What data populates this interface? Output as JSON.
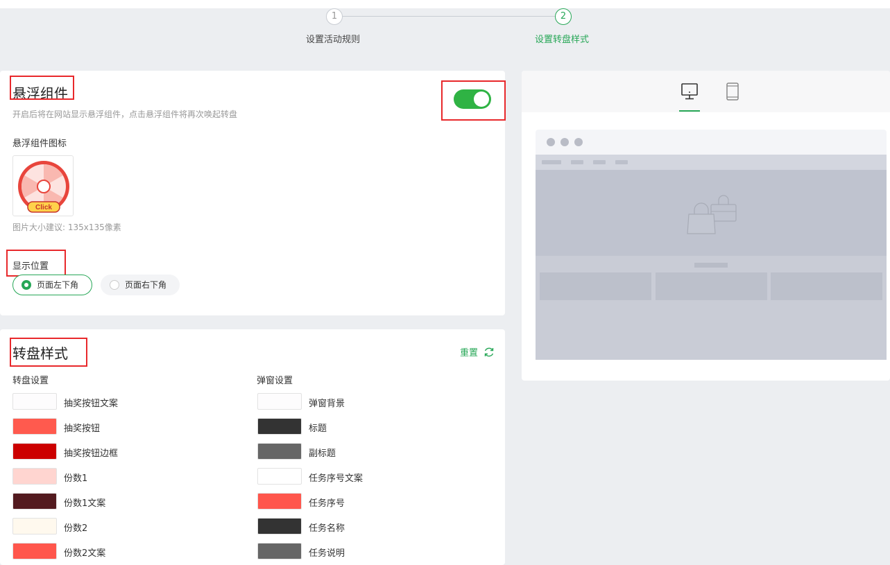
{
  "steps": [
    {
      "number": "1",
      "label": "设置活动规则"
    },
    {
      "number": "2",
      "label": "设置转盘样式"
    }
  ],
  "float_widget": {
    "title": "悬浮组件",
    "description": "开启后将在网站显示悬浮组件，点击悬浮组件将再次唤起转盘",
    "enabled": true,
    "icon_label": "悬浮组件图标",
    "icon_badge_text": "Click",
    "size_hint": "图片大小建议: 135x135像素",
    "position_label": "显示位置",
    "positions": [
      {
        "label": "页面左下角",
        "selected": true
      },
      {
        "label": "页面右下角",
        "selected": false
      }
    ]
  },
  "wheel_style": {
    "title": "转盘样式",
    "reset_label": "重置",
    "wheel_settings": {
      "title": "转盘设置",
      "items": [
        {
          "label": "抽奖按钮文案",
          "color": "#fdfcfd"
        },
        {
          "label": "抽奖按钮",
          "color": "#ff5a4e"
        },
        {
          "label": "抽奖按钮边框",
          "color": "#cc0000"
        },
        {
          "label": "份数1",
          "color": "#ffd5d0"
        },
        {
          "label": "份数1文案",
          "color": "#531a1f"
        },
        {
          "label": "份数2",
          "color": "#fff9ee"
        },
        {
          "label": "份数2文案",
          "color": "#ff564c"
        }
      ]
    },
    "popup_settings": {
      "title": "弹窗设置",
      "items": [
        {
          "label": "弹窗背景",
          "color": "#fdfcfd"
        },
        {
          "label": "标题",
          "color": "#333333"
        },
        {
          "label": "副标题",
          "color": "#666666"
        },
        {
          "label": "任务序号文案",
          "color": "#ffffff"
        },
        {
          "label": "任务序号",
          "color": "#ff564c"
        },
        {
          "label": "任务名称",
          "color": "#333333"
        },
        {
          "label": "任务说明",
          "color": "#666666"
        }
      ]
    }
  },
  "preview": {
    "tabs": [
      {
        "icon": "desktop-monitor-icon",
        "active": true
      },
      {
        "icon": "tablet-mobile-icon",
        "active": false
      }
    ]
  },
  "colors": {
    "accent": "#27a757",
    "toggle_on": "#2fb344",
    "annotation": "#e8282b"
  }
}
